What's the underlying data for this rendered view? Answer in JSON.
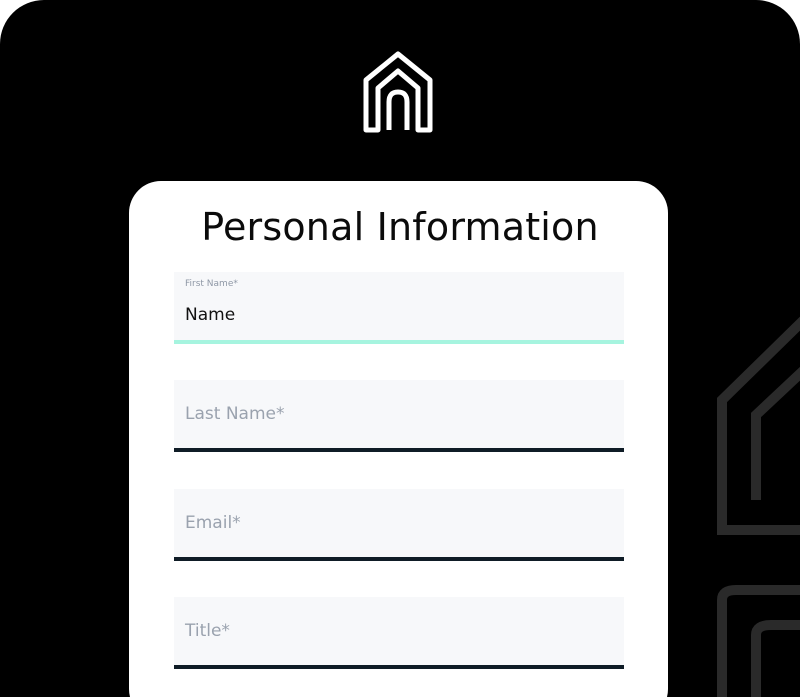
{
  "brand": {
    "logo_icon": "house-logo-icon"
  },
  "form": {
    "title": "Personal Information",
    "fields": [
      {
        "label": "First Name*",
        "value": "Name",
        "active": true
      },
      {
        "placeholder": "Last Name*"
      },
      {
        "placeholder": "Email*"
      },
      {
        "placeholder": "Title*"
      }
    ]
  },
  "colors": {
    "background": "#000000",
    "card": "#ffffff",
    "field_bg": "#f7f8fa",
    "active_underline": "#a6f4df",
    "underline": "#0f1c26"
  }
}
